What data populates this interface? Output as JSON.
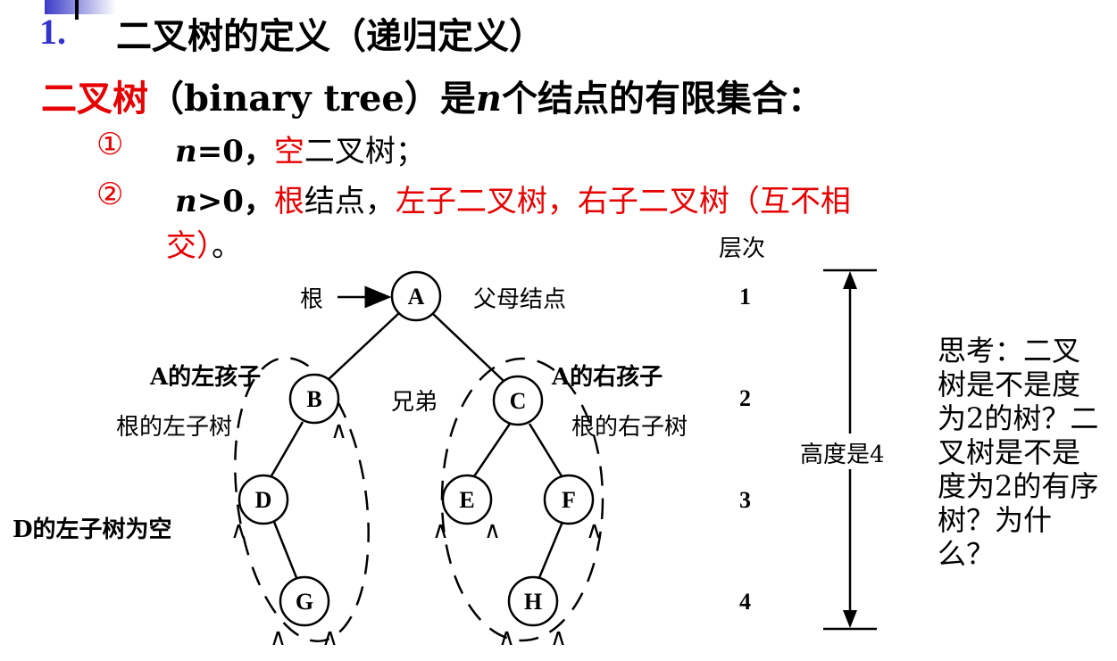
{
  "heading": {
    "number": "1.",
    "text": "二叉树的定义（递归定义）"
  },
  "definition": {
    "term": "二叉树",
    "rest_a": "（binary tree）是",
    "n": "n",
    "rest_b": "个结点的有限集合："
  },
  "items": [
    {
      "marker": "①",
      "n": "n",
      "cond": "=0，",
      "red": "空",
      "rest": "二叉树；"
    },
    {
      "marker": "②",
      "n": "n",
      "cond": ">0，",
      "red1": "根",
      "mid": "结点，",
      "red2": "左子二叉树，右子二叉树（互不相",
      "red3": "交）",
      "end": "。"
    }
  ],
  "diagram": {
    "nodes": [
      "A",
      "B",
      "C",
      "D",
      "E",
      "F",
      "G",
      "H"
    ],
    "labels": {
      "root": "根",
      "parent": "父母结点",
      "a_left_child": "A的左孩子",
      "a_right_child": "A的右孩子",
      "root_left_subtree": "根的左子树",
      "root_right_subtree": "根的右子树",
      "sibling": "兄弟",
      "d_left_empty": "D的左子树为空",
      "null_mark": "∧"
    },
    "level_header": "层次",
    "levels": [
      "1",
      "2",
      "3",
      "4"
    ],
    "height_label": "高度是4"
  },
  "thinking": "思考：二叉树是不是度为2的树？二叉树是不是度为2的有序树？为什么？"
}
